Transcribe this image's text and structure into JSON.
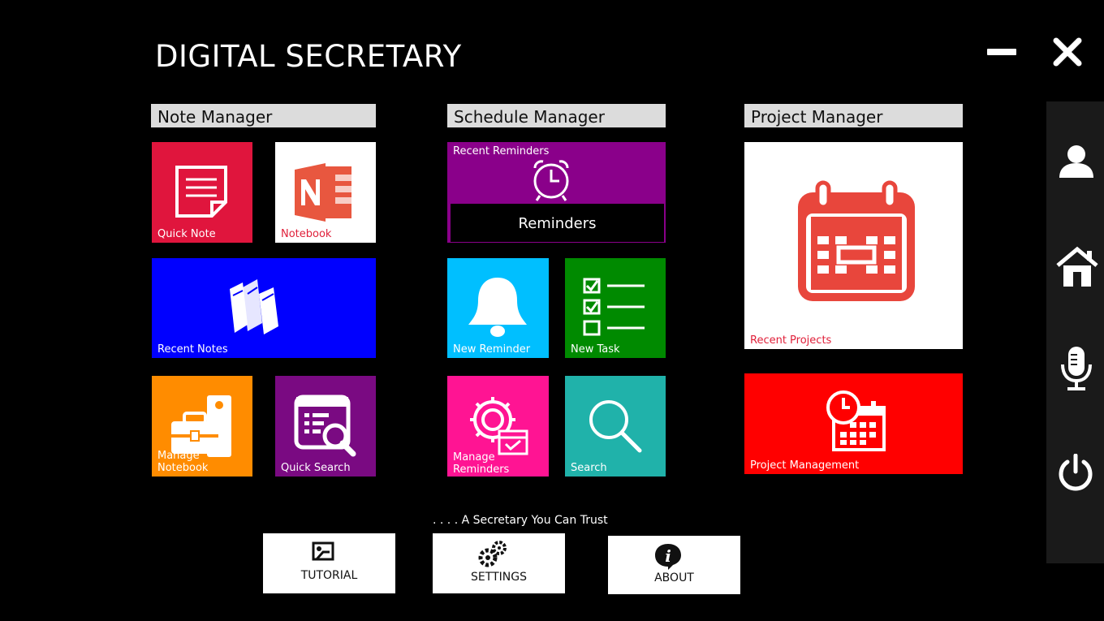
{
  "app": {
    "title": "DIGITAL SECRETARY"
  },
  "window_controls": {
    "minimize_icon": "minimize-icon",
    "close_icon": "close-icon"
  },
  "sections": {
    "note_manager": {
      "title": "Note Manager"
    },
    "schedule_manager": {
      "title": "Schedule Manager"
    },
    "project_manager": {
      "title": "Project Manager"
    }
  },
  "tiles": {
    "quick_note": {
      "label": "Quick Note",
      "color": "#e0153d",
      "icon": "note-icon"
    },
    "notebook": {
      "label": "Notebook",
      "color": "#ffffff",
      "label_color": "#e0203a",
      "icon": "onenote-icon"
    },
    "recent_notes": {
      "label": "Recent Notes",
      "color": "#0000ff",
      "icon": "books-icon"
    },
    "manage_notebook": {
      "label": "Manage Notebook",
      "color": "#ff8c00",
      "icon": "toolbox-icon"
    },
    "quick_search": {
      "label": "Quick Search",
      "color": "#7a0a82",
      "icon": "search-document-icon"
    },
    "recent_reminders": {
      "label": "Recent Reminders",
      "color": "#8a008a",
      "icon": "alarm-clock-icon",
      "sub_label": "Reminders"
    },
    "new_reminder": {
      "label": "New Reminder",
      "color": "#00bfff",
      "icon": "bell-icon"
    },
    "new_task": {
      "label": "New Task",
      "color": "#008a00",
      "icon": "checklist-icon"
    },
    "manage_reminders": {
      "label": "Manage Reminders",
      "color": "#ff1493",
      "icon": "gear-calendar-icon"
    },
    "search": {
      "label": "Search",
      "color": "#20b2aa",
      "icon": "search-icon"
    },
    "recent_projects": {
      "label": "Recent Projects",
      "color": "#ffffff",
      "label_color": "#e0203a",
      "icon": "calendar-icon"
    },
    "project_management": {
      "label": "Project Management",
      "color": "#ff0000",
      "icon": "clock-calendar-icon"
    }
  },
  "sidebar": {
    "items": [
      {
        "name": "user",
        "icon": "user-icon"
      },
      {
        "name": "home",
        "icon": "home-icon"
      },
      {
        "name": "microphone",
        "icon": "microphone-icon"
      },
      {
        "name": "power",
        "icon": "power-icon"
      }
    ]
  },
  "footer": {
    "tagline": ". . . . A Secretary You Can Trust",
    "tutorial_label": "TUTORIAL",
    "settings_label": "SETTINGS",
    "about_label": "ABOUT"
  }
}
